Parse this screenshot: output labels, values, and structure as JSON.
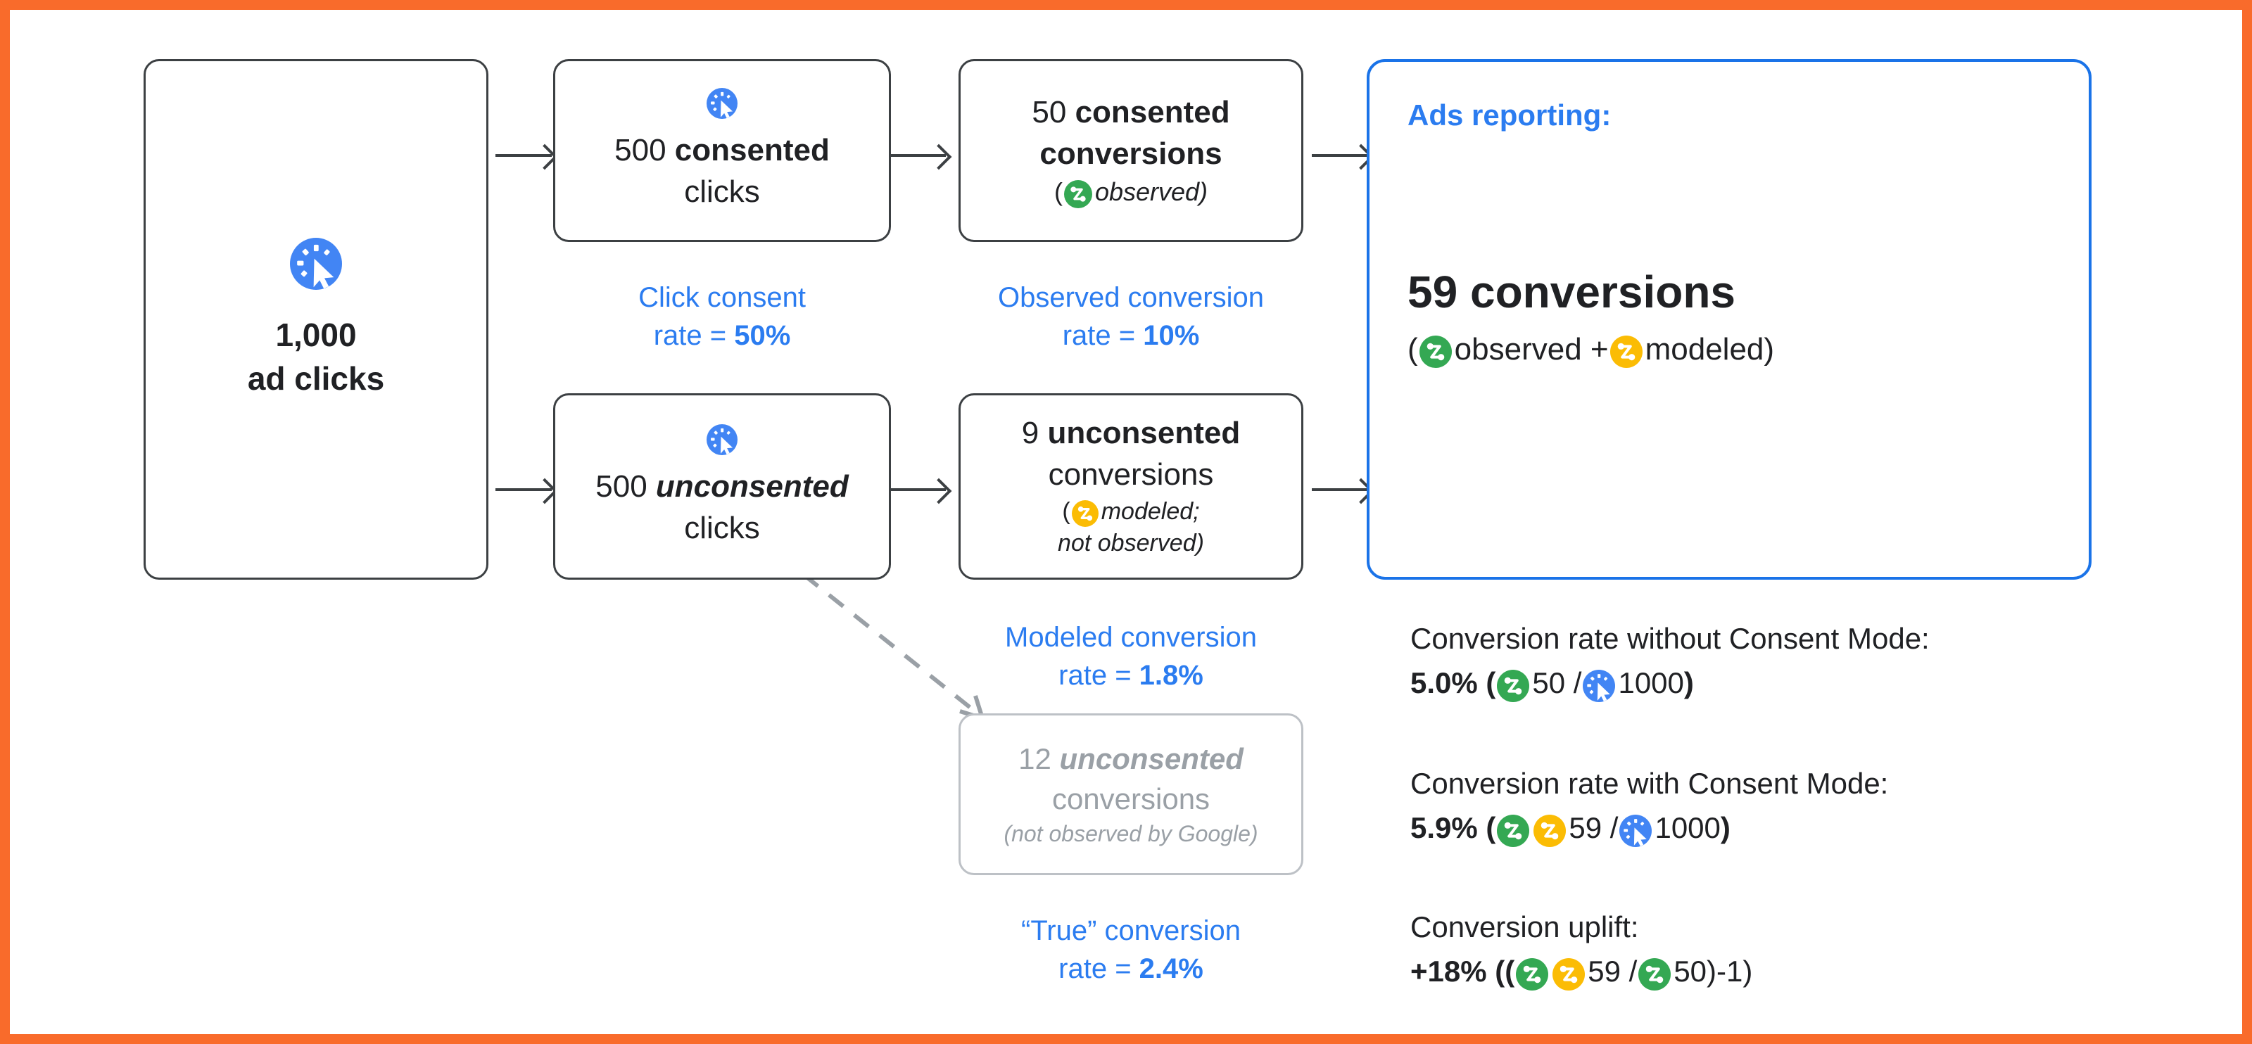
{
  "frame": {
    "accent_border_color": "#f96b2b"
  },
  "colors": {
    "blue_accent": "#2b7cf0",
    "blue_box": "#1a73e8",
    "green_badge": "#34a853",
    "yellow_badge": "#fbbc04",
    "blue_badge": "#4285f4",
    "gray_text": "#9aa0a6",
    "dark_text": "#202124"
  },
  "nodes": {
    "ad_clicks": {
      "count": "1,000",
      "label": "ad clicks",
      "icon": "ad-click-icon"
    },
    "consented_clicks": {
      "count": "500",
      "emphasis": "consented",
      "label": "clicks",
      "icon": "ad-click-icon"
    },
    "unconsented_clicks": {
      "count": "500",
      "emphasis": "unconsented",
      "label": "clicks",
      "icon": "ad-click-icon"
    },
    "consented_conversions": {
      "count": "50",
      "emphasis": "consented",
      "label": "conversions",
      "note_open": "(",
      "note": "observed",
      "note_close": ")",
      "icon": "conversion-observed-icon"
    },
    "unconsented_conversions": {
      "count": "9",
      "emphasis": "unconsented",
      "label": "conversions",
      "note_open": "(",
      "note": "modeled;",
      "note_line2": "not observed)",
      "icon": "conversion-modeled-icon"
    },
    "true_unconsented_conversions": {
      "count": "12",
      "emphasis": "unconsented",
      "label": "conversions",
      "note": "(not observed by Google)"
    },
    "ads_reporting": {
      "title": "Ads reporting:",
      "headline_number": "59",
      "headline_label": "conversions",
      "breakdown_open": "(",
      "breakdown_observed": "observed",
      "breakdown_plus": "+",
      "breakdown_modeled": "modeled",
      "breakdown_close": ")"
    }
  },
  "captions": {
    "click_consent": {
      "line1": "Click consent",
      "line2_prefix": "rate = ",
      "value": "50%"
    },
    "observed_conversion": {
      "line1": "Observed conversion",
      "line2_prefix": "rate = ",
      "value": "10%"
    },
    "modeled_conversion": {
      "line1": "Modeled conversion",
      "line2_prefix": "rate = ",
      "value": "1.8%"
    },
    "true_conversion": {
      "line1": "“True” conversion",
      "line2_prefix": "rate = ",
      "value": "2.4%"
    }
  },
  "stats": [
    {
      "heading": "Conversion rate without Consent Mode:",
      "value": "5.0%",
      "open": "(",
      "numerator": "50",
      "divider": "/",
      "denominator": "1000",
      "close": ")"
    },
    {
      "heading": "Conversion rate with Consent Mode:",
      "value": "5.9%",
      "open": "(",
      "numerator": "59",
      "divider": "/",
      "denominator": "1000",
      "close": ")"
    },
    {
      "heading": "Conversion uplift:",
      "value": "+18%",
      "open": "((",
      "numerator": "59",
      "divider": "/",
      "denominator": "50",
      "close": ")-1)"
    }
  ],
  "chart_data": {
    "type": "diagram",
    "title": "Google Ads Consent Mode conversion modeling flow",
    "nodes": [
      {
        "id": "ad_clicks",
        "label": "1,000 ad clicks",
        "value": 1000
      },
      {
        "id": "consented_clicks",
        "label": "500 consented clicks",
        "value": 500
      },
      {
        "id": "unconsented_clicks",
        "label": "500 unconsented clicks",
        "value": 500
      },
      {
        "id": "consented_conversions",
        "label": "50 consented conversions (observed)",
        "value": 50
      },
      {
        "id": "unconsented_conversions",
        "label": "9 unconsented conversions (modeled; not observed)",
        "value": 9
      },
      {
        "id": "true_unconsented_conversions",
        "label": "12 unconsented conversions (not observed by Google)",
        "value": 12
      },
      {
        "id": "ads_reporting",
        "label": "Ads reporting: 59 conversions",
        "value": 59
      }
    ],
    "rates": {
      "click_consent_rate": 50,
      "observed_conversion_rate": 10,
      "modeled_conversion_rate": 1.8,
      "true_conversion_rate": 2.4,
      "conversion_rate_without_consent_mode": 5.0,
      "conversion_rate_with_consent_mode": 5.9,
      "conversion_uplift": 18
    }
  }
}
